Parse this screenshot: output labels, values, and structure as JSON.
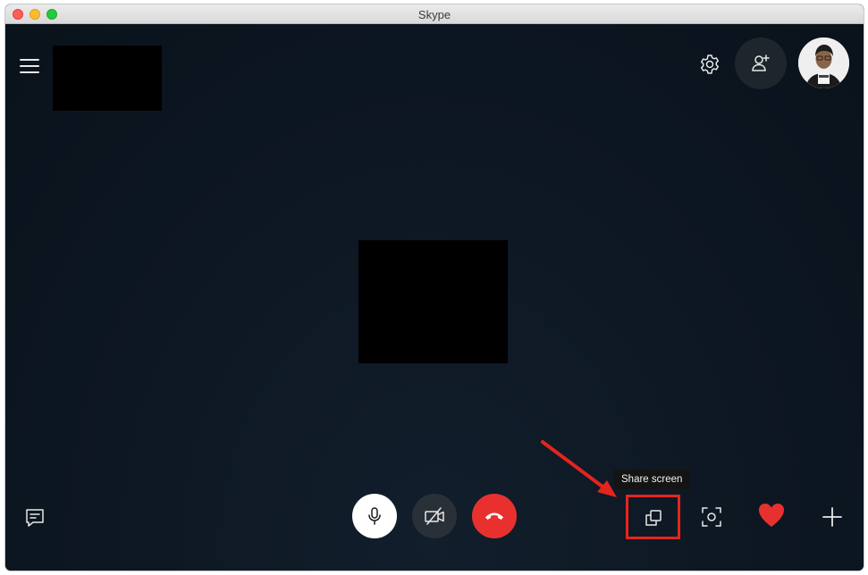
{
  "window": {
    "title": "Skype"
  },
  "tooltip": {
    "text": "Share screen"
  },
  "icons": {
    "menu": "hamburger-menu-icon",
    "settings": "gear-icon",
    "add_participant": "person-add-icon",
    "chat": "chat-bubble-icon",
    "microphone": "microphone-icon",
    "video_off": "video-camera-off-icon",
    "hang_up": "phone-hangup-icon",
    "share_screen": "share-screen-icon",
    "snapshot": "camera-snapshot-icon",
    "reaction": "heart-icon",
    "more": "plus-icon"
  },
  "colors": {
    "background": "#0c141d",
    "hangup": "#e8312f",
    "annotation": "#e5241d",
    "heart": "#e8312f"
  }
}
